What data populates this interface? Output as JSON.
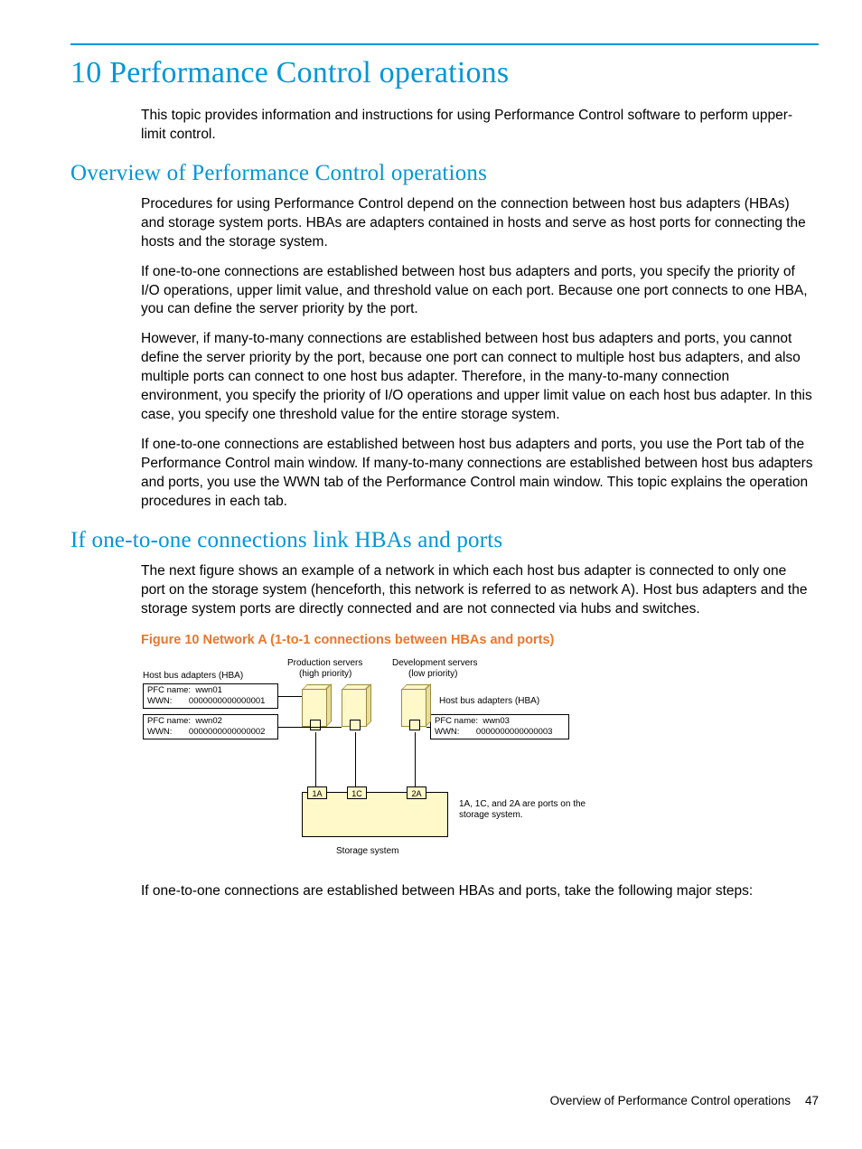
{
  "headings": {
    "h1": "10 Performance Control operations",
    "h2a": "Overview of Performance Control operations",
    "h2b": "If one-to-one connections link HBAs and ports"
  },
  "paragraphs": {
    "intro": "This topic provides information and instructions for using Performance Control software to perform upper-limit control.",
    "ov1": "Procedures for using Performance Control depend on the connection between host bus adapters (HBAs) and storage system ports. HBAs are adapters contained in hosts and serve as host ports for connecting the hosts and the storage system.",
    "ov2": "If one-to-one connections are established between host bus adapters and ports, you specify the priority of I/O operations, upper limit value, and threshold value on each port. Because one port connects to one HBA, you can define the server priority by the port.",
    "ov3": "However, if many-to-many connections are established between host bus adapters and ports, you cannot define the server priority by the port, because one port can connect to multiple host bus adapters, and also multiple ports can connect to one host bus adapter. Therefore, in the many-to-many connection environment, you specify the priority of I/O operations and upper limit value on each host bus adapter. In this case, you specify one threshold value for the entire storage system.",
    "ov4": "If one-to-one connections are established between host bus adapters and ports, you use the Port tab of the Performance Control main window. If many-to-many connections are established between host bus adapters and ports, you use the WWN tab of the Performance Control main window. This topic explains the operation procedures in each tab.",
    "oto1": "The next figure shows an example of a network in which each host bus adapter is connected to only one port on the storage system (henceforth, this network is referred to as network A). Host bus adapters and the storage system ports are directly connected and are not connected via hubs and switches.",
    "oto2": "If one-to-one connections are established between HBAs and ports, take the following major steps:"
  },
  "figure": {
    "caption": "Figure 10 Network A (1-to-1 connections between HBAs and ports)",
    "labels": {
      "hba_left": "Host bus adapters (HBA)",
      "hba_right": "Host bus adapters (HBA)",
      "prod_servers": "Production servers",
      "high_priority": "(high priority)",
      "dev_servers": "Development servers",
      "low_priority": "(low priority)",
      "storage_system": "Storage system",
      "ports_note": "1A, 1C, and 2A are ports on the storage system."
    },
    "hba1": {
      "pfc_label": "PFC name:",
      "pfc": "wwn01",
      "wwn_label": "WWN:",
      "wwn": "0000000000000001"
    },
    "hba2": {
      "pfc_label": "PFC name:",
      "pfc": "wwn02",
      "wwn_label": "WWN:",
      "wwn": "0000000000000002"
    },
    "hba3": {
      "pfc_label": "PFC name:",
      "pfc": "wwn03",
      "wwn_label": "WWN:",
      "wwn": "0000000000000003"
    },
    "ports": {
      "p1": "1A",
      "p2": "1C",
      "p3": "2A"
    }
  },
  "footer": {
    "text": "Overview of Performance Control operations",
    "page": "47"
  }
}
